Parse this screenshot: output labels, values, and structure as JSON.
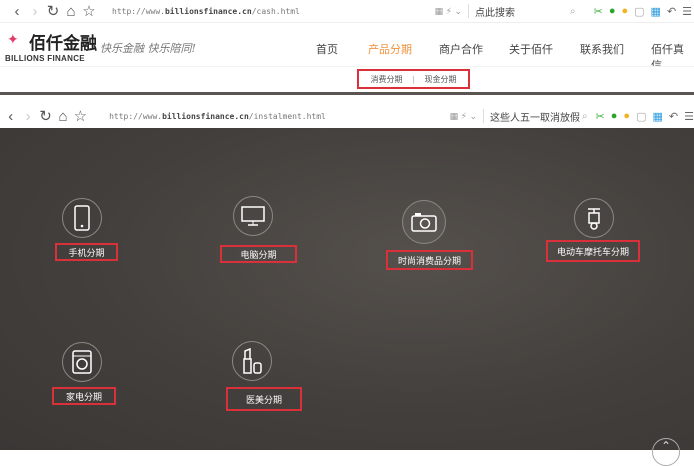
{
  "browser1": {
    "url_prefix": "http://www.",
    "url_domain": "billionsfinance.cn",
    "url_path": "/cash.html",
    "search": "点此搜索"
  },
  "browser2": {
    "url_prefix": "http://www.",
    "url_domain": "billionsfinance.cn",
    "url_path": "/instalment.html",
    "search": "这些人五一取消放假"
  },
  "logo": {
    "cn": "佰仟金融",
    "en": "BILLIONS FINANCE"
  },
  "slogan": "快乐金融 快乐陪同!",
  "nav": [
    "首页",
    "产品分期",
    "商户合作",
    "关于佰仟",
    "联系我们",
    "佰仟真信"
  ],
  "active_color": "#f0913c",
  "subnav": [
    "消费分期",
    "|",
    "现金分期"
  ],
  "products": [
    "手机分期",
    "电脑分期",
    "时尚消费品分期",
    "电动车摩托车分期",
    "家电分期",
    "医美分期"
  ]
}
